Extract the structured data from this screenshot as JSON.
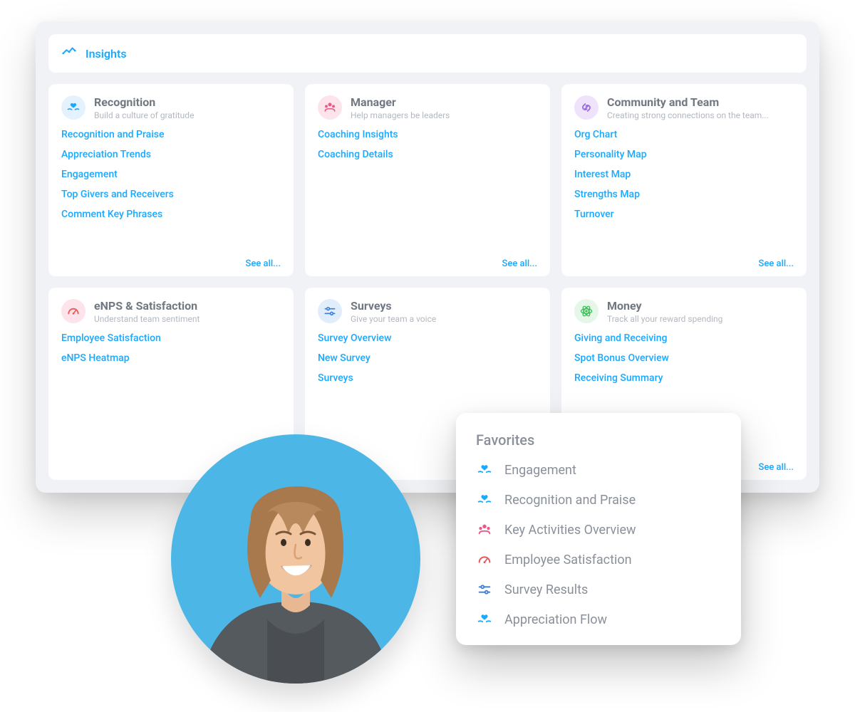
{
  "header": {
    "title": "Insights"
  },
  "see_all_label": "See all...",
  "cards": [
    {
      "id": "recognition",
      "title": "Recognition",
      "subtitle": "Build a culture of gratitude",
      "icon": "hands-heart",
      "icon_bg": "bg-blue",
      "links": [
        "Recognition and Praise",
        "Appreciation Trends",
        "Engagement",
        "Top Givers and Receivers",
        "Comment Key Phrases"
      ]
    },
    {
      "id": "manager",
      "title": "Manager",
      "subtitle": "Help managers be leaders",
      "icon": "team",
      "icon_bg": "bg-pink",
      "links": [
        "Coaching Insights",
        "Coaching Details"
      ]
    },
    {
      "id": "community",
      "title": "Community and Team",
      "subtitle": "Creating strong connections on the team...",
      "icon": "link",
      "icon_bg": "bg-purple",
      "links": [
        "Org Chart",
        "Personality Map",
        "Interest Map",
        "Strengths Map",
        "Turnover"
      ]
    },
    {
      "id": "enps",
      "title": "eNPS & Satisfaction",
      "subtitle": "Understand team sentiment",
      "icon": "gauge",
      "icon_bg": "bg-pink",
      "links": [
        "Employee Satisfaction",
        "eNPS Heatmap"
      ]
    },
    {
      "id": "surveys",
      "title": "Surveys",
      "subtitle": "Give your team a voice",
      "icon": "sliders",
      "icon_bg": "bg-lblue",
      "links": [
        "Survey Overview",
        "New Survey",
        "Surveys"
      ]
    },
    {
      "id": "money",
      "title": "Money",
      "subtitle": "Track all your reward spending",
      "icon": "atom",
      "icon_bg": "bg-green",
      "links": [
        "Giving and Receiving",
        "Spot Bonus Overview",
        "Receiving Summary"
      ]
    }
  ],
  "favorites": {
    "title": "Favorites",
    "items": [
      {
        "icon": "hands-heart",
        "label": "Engagement"
      },
      {
        "icon": "hands-heart",
        "label": "Recognition and Praise"
      },
      {
        "icon": "team",
        "label": "Key Activities Overview"
      },
      {
        "icon": "gauge",
        "label": "Employee Satisfaction"
      },
      {
        "icon": "sliders",
        "label": "Survey Results"
      },
      {
        "icon": "hands-heart",
        "label": "Appreciation Flow"
      }
    ]
  },
  "colors": {
    "accent": "#1aa9ff",
    "pink": "#e85a8a",
    "purple": "#9a6be0",
    "green": "#3fbf5a",
    "red": "#e85a5a"
  }
}
